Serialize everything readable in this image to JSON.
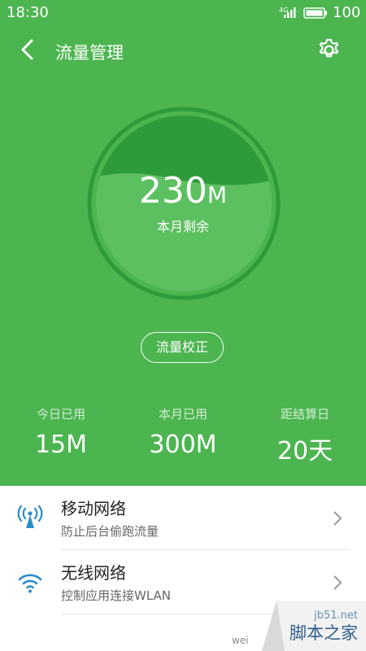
{
  "status_bar": {
    "time": "18:30",
    "network": "4G",
    "battery": "100"
  },
  "header": {
    "title": "流量管理",
    "back_icon": "chevron-left-icon",
    "settings_icon": "gear-icon"
  },
  "gauge": {
    "remaining_value": "230",
    "remaining_unit": "M",
    "remaining_label": "本月剩余",
    "water_fraction": 0.62
  },
  "calibrate_button": "流量校正",
  "stats": [
    {
      "label": "今日已用",
      "value": "15M"
    },
    {
      "label": "本月已用",
      "value": "300M"
    },
    {
      "label": "距结算日",
      "value": "20天"
    }
  ],
  "list": [
    {
      "title": "移动网络",
      "subtitle": "防止后台偷跑流量",
      "icon": "mobile-antenna-icon"
    },
    {
      "title": "无线网络",
      "subtitle": "控制应用连接WLAN",
      "icon": "wifi-icon"
    }
  ],
  "watermark": {
    "site": "jb51.net",
    "name": "脚本之家",
    "partial": "wei"
  },
  "colors": {
    "primary_green": "#4cb550",
    "dark_green": "#2f9a3a",
    "icon_blue": "#2a8ccc"
  }
}
